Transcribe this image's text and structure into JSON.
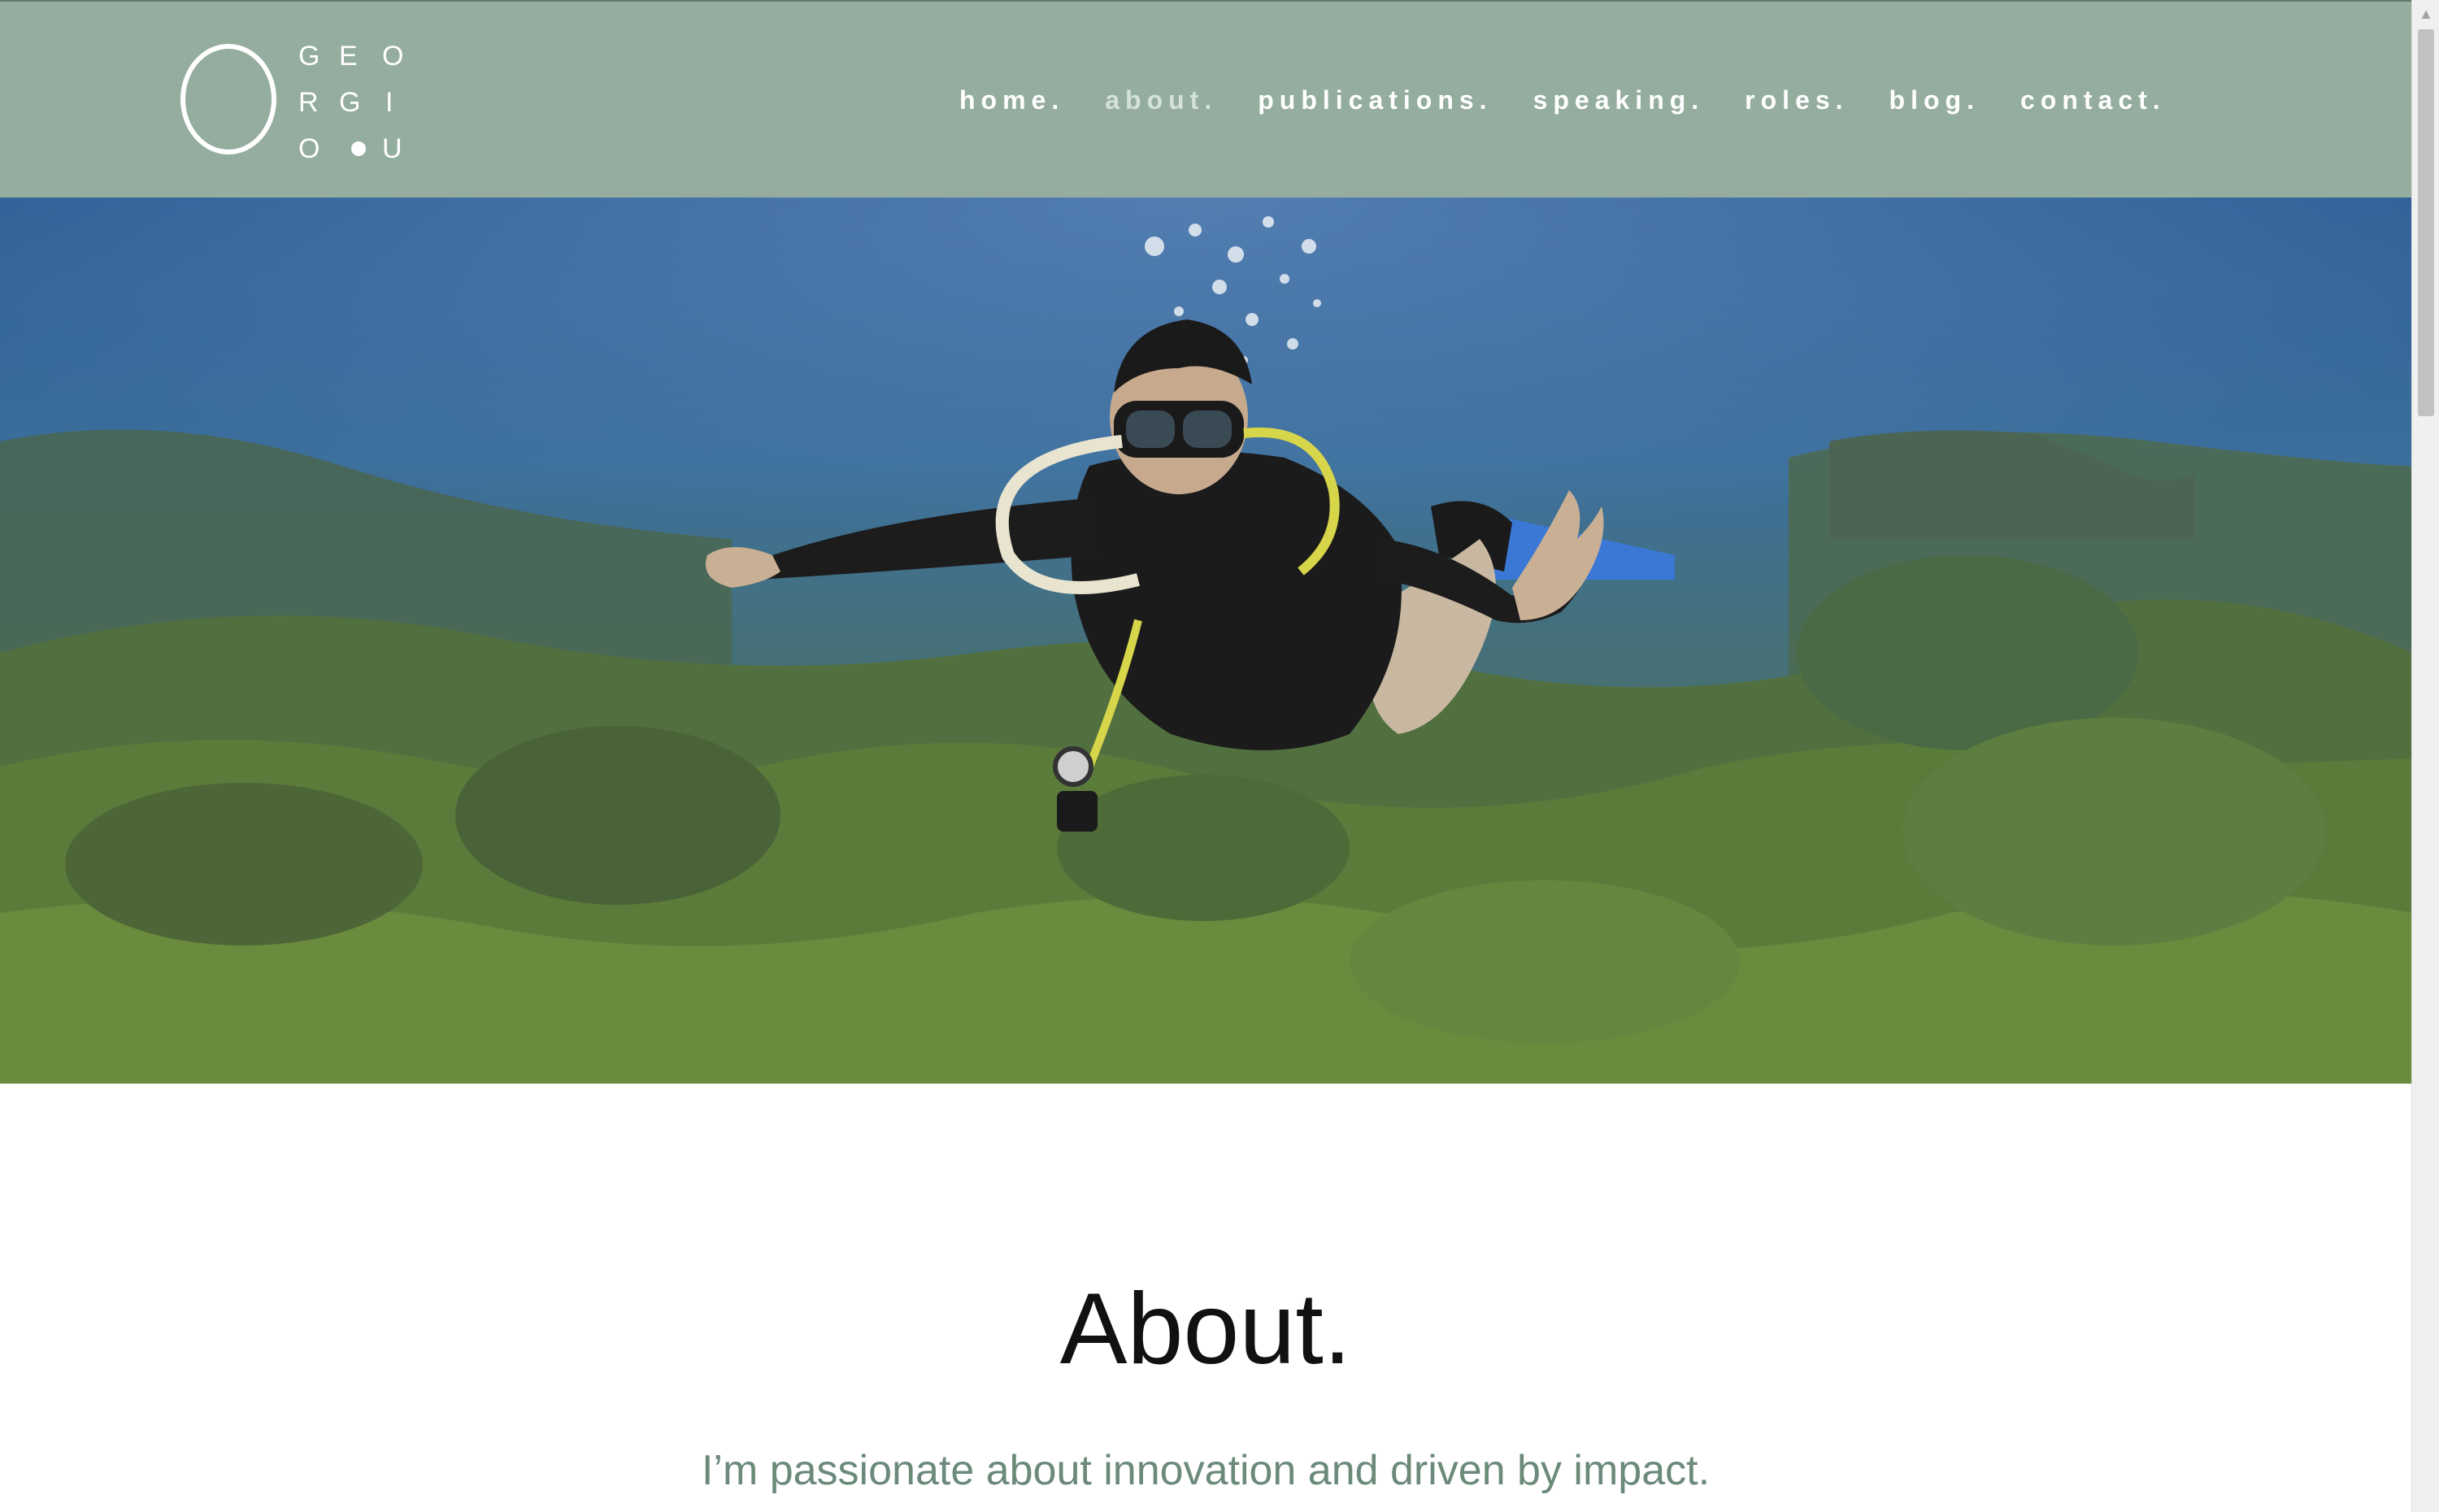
{
  "logo": {
    "letters": [
      "G",
      "E",
      "O",
      "R",
      "G",
      "I",
      "O",
      "U"
    ]
  },
  "nav": {
    "items": [
      {
        "label": "home.",
        "active": false
      },
      {
        "label": "about.",
        "active": true
      },
      {
        "label": "publications.",
        "active": false
      },
      {
        "label": "speaking.",
        "active": false
      },
      {
        "label": "roles.",
        "active": false
      },
      {
        "label": "blog.",
        "active": false
      },
      {
        "label": "contact.",
        "active": false
      }
    ]
  },
  "hero": {
    "image": "scuba-diver-underwater-reef-photo"
  },
  "content": {
    "title": "About.",
    "tagline": "I’m passionate about innovation and driven by impact."
  },
  "colors": {
    "header_bg": "#94ad9f",
    "tagline": "#6b8a7a",
    "active_nav": "#d4e2d9"
  }
}
